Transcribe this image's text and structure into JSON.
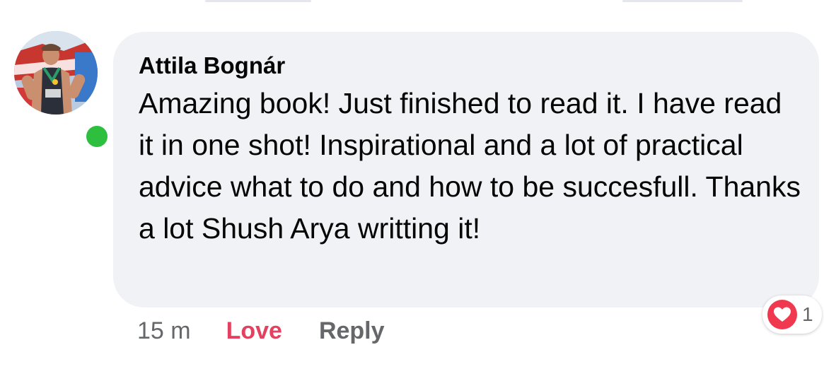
{
  "comment": {
    "author": "Attila Bognár",
    "text": "Amazing book! Just finished to read it. I have read it in one shot! Inspirational and a lot of practical advice what to do and how to be succesfull. Thanks a lot Shush Arya writting it!",
    "online": true
  },
  "actions": {
    "time": "15 m",
    "love_label": "Love",
    "reply_label": "Reply"
  },
  "reactions": {
    "type_icon": "heart-icon",
    "count": "1"
  },
  "colors": {
    "bubble_bg": "#f0f2f5",
    "love": "#e4405f",
    "muted": "#65676b",
    "online": "#2fbf3f",
    "heart": "#f0384f"
  }
}
